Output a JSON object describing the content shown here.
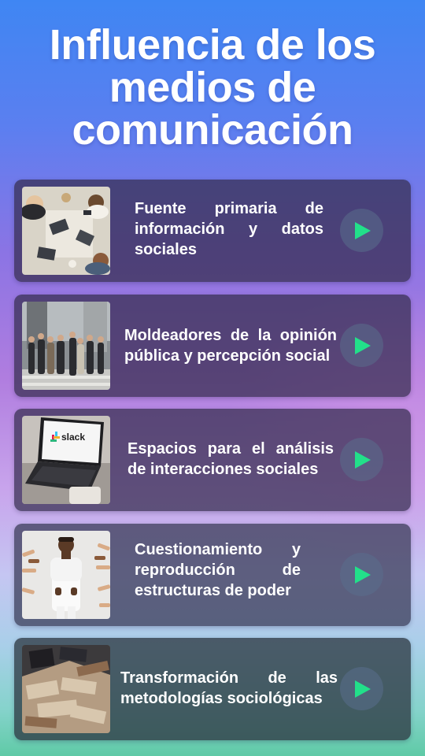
{
  "title": "Influencia de los medios de comunicación",
  "items": [
    {
      "text": "Fuente primaria de información y datos sociales",
      "photo_icon": "team-meeting-photo-icon",
      "action_icon": "play-icon"
    },
    {
      "text": "Moldeadores de la opinión pública y percepción social",
      "photo_icon": "crowd-street-photo-icon",
      "action_icon": "play-icon"
    },
    {
      "text": "Espacios para el análisis de interacciones sociales",
      "photo_icon": "laptop-slack-photo-icon",
      "action_icon": "play-icon"
    },
    {
      "text": "Cuestionamiento y reproducción de estructuras de poder",
      "photo_icon": "pointing-hands-photo-icon",
      "action_icon": "play-icon"
    },
    {
      "text": "Transformación de las metodologías sociológicas",
      "photo_icon": "old-books-photo-icon",
      "action_icon": "play-icon"
    }
  ],
  "laptop_logo_text": "slack",
  "colors": {
    "play_triangle": "#22e08a",
    "card_background": "#342c4e",
    "title_text": "#ffffff"
  }
}
